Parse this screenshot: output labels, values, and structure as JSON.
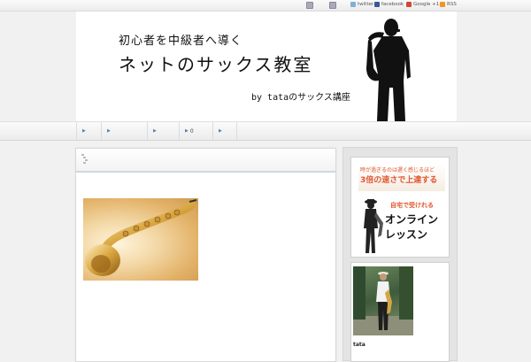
{
  "topbar": {
    "social_links": [
      {
        "label": "twitter",
        "icon": "twitter-icon",
        "color": "#7fb0d8"
      },
      {
        "label": "facebook",
        "icon": "facebook-icon",
        "color": "#3b5998"
      },
      {
        "label": "Google +1",
        "icon": "google-plus-icon",
        "color": "#d14836"
      },
      {
        "label": "RSS",
        "icon": "rss-icon",
        "color": "#f29423"
      }
    ]
  },
  "header": {
    "subtitle": "初心者を中級者へ導く",
    "title": "ネットのサックス教室",
    "byline": "by tataのサックス講座"
  },
  "nav": {
    "items": [
      {
        "label": ""
      },
      {
        "label": ""
      },
      {
        "label": ""
      },
      {
        "label": "0"
      },
      {
        "label": ""
      }
    ]
  },
  "post": {
    "title": "",
    "image_alt": "saxophone-photo"
  },
  "sidebar": {
    "ad": {
      "line1": "時が過ぎるのは遅く感じるほど",
      "line2": "3倍の速さで上達する",
      "line3": "自宅で受けれる",
      "line4": "オンライン",
      "line5": "レッスン"
    },
    "profile": {
      "name": "tata"
    }
  },
  "colors": {
    "accent_orange": "#e0572f",
    "nav_arrow": "#5a7fa8"
  }
}
